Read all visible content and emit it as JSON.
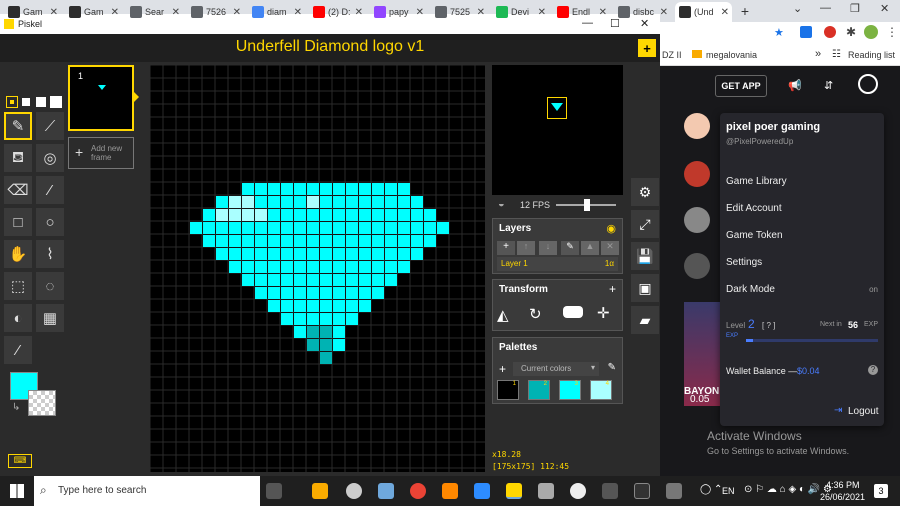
{
  "browser": {
    "tabs": [
      {
        "label": "Gam",
        "color": "#2d2d2d"
      },
      {
        "label": "Gam",
        "color": "#2d2d2d"
      },
      {
        "label": "Sear",
        "color": "#5f6368"
      },
      {
        "label": "7526",
        "color": "#5f6368"
      },
      {
        "label": "diam",
        "color": "#4285f4"
      },
      {
        "label": "(2) D:",
        "color": "#ff0000"
      },
      {
        "label": "papy",
        "color": "#9146ff"
      },
      {
        "label": "7525",
        "color": "#5f6368"
      },
      {
        "label": "Devi",
        "color": "#1db954"
      },
      {
        "label": "Endl",
        "color": "#ff0000"
      },
      {
        "label": "disbc",
        "color": "#5f6368"
      },
      {
        "label": "(Und",
        "color": "#2d2d2d"
      }
    ],
    "new_tab": "+",
    "bookmark_items": [
      "DZ II",
      "megalovania"
    ],
    "reading_list": "Reading list"
  },
  "window": {
    "app_name": "Piskel",
    "doc_title": "Underfell Diamond logo v1",
    "frame_number": "1",
    "add_frame": "Add new frame",
    "fps": "12 FPS",
    "coords_zoom": "x18.28",
    "coords_pos": "[175x175] 112:45"
  },
  "layers": {
    "title": "Layers",
    "layer_name": "Layer 1",
    "layer_alpha": "1α"
  },
  "transform": {
    "title": "Transform"
  },
  "palettes": {
    "title": "Palettes",
    "selector": "Current colors",
    "swatches": [
      {
        "num": "1",
        "color": "#000000"
      },
      {
        "num": "2",
        "color": "#00b3b3"
      },
      {
        "num": "3",
        "color": "#00ffff"
      },
      {
        "num": "4",
        "color": "#aaffff"
      }
    ]
  },
  "colors": {
    "primary": "#00ffff",
    "accent": "#ffd700",
    "diamond_main": "#00ffff",
    "diamond_light": "#aaffff",
    "diamond_dark": "#00b3b3"
  },
  "overlay": {
    "get_app": "GET APP",
    "username": "pixel poer gaming",
    "handle": "@PixelPoweredUp",
    "menu": [
      "Game Library",
      "Edit Account",
      "Game Token",
      "Settings",
      "Dark Mode"
    ],
    "dark_mode_state": "on",
    "level_label": "Level",
    "level_value": "2",
    "level_hint": "[ ? ]",
    "next_in_label": "Next in",
    "next_in_value": "56",
    "exp_label": "EXP",
    "exp_progress": 0.05,
    "wallet_label": "Wallet Balance —",
    "wallet_value": "$0.04",
    "logout": "Logout",
    "activate_title": "Activate Windows",
    "activate_sub": "Go to Settings to activate Windows.",
    "side_label": "BAYON",
    "side_value": "0.05"
  },
  "taskbar": {
    "search_placeholder": "Type here to search",
    "lang": "EN",
    "time": "4:36 PM",
    "date": "26/06/2021",
    "notif_count": "3"
  }
}
